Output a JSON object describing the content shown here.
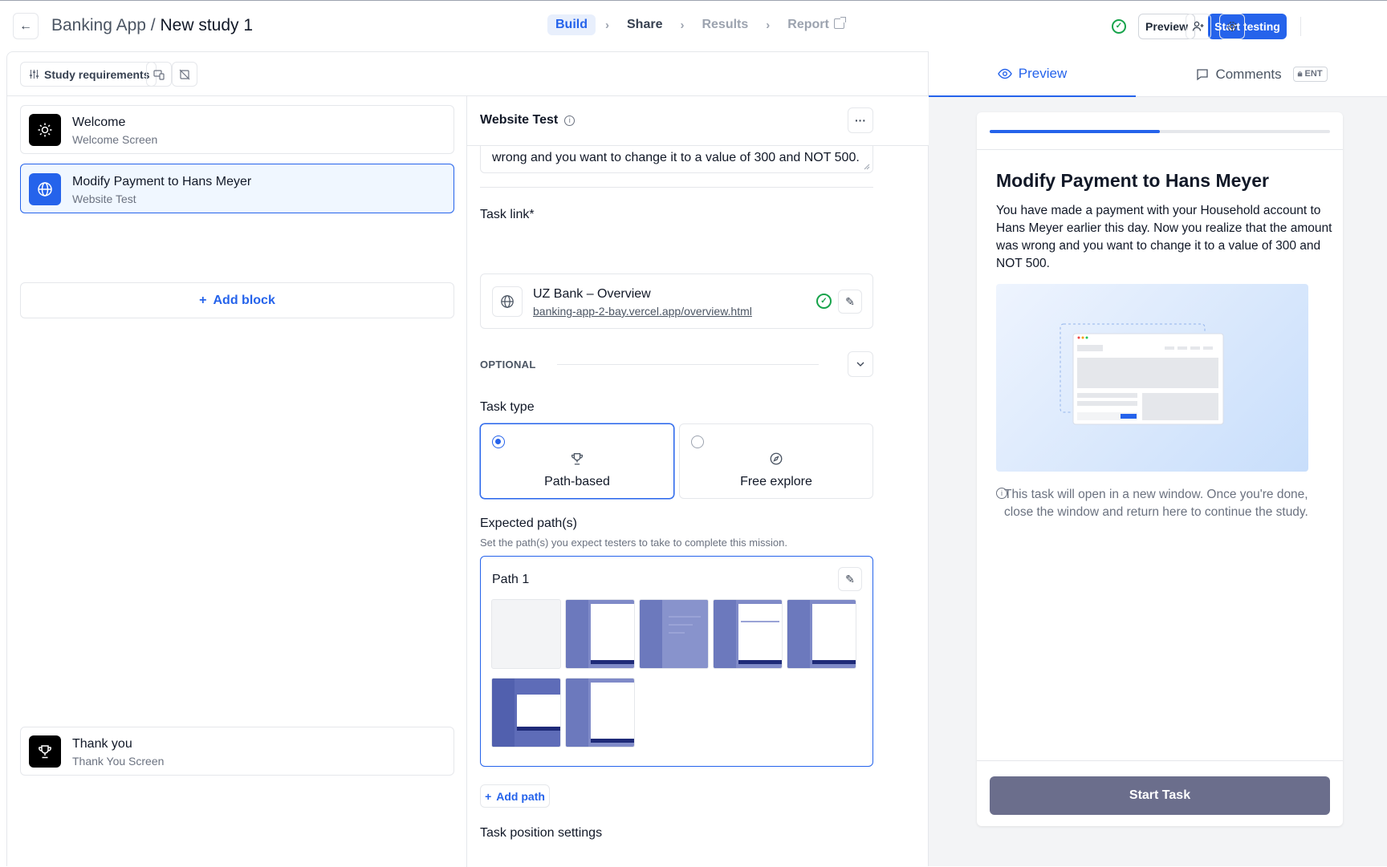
{
  "header": {
    "back_icon": "arrow-left-icon",
    "project": "Banking App",
    "separator": "/",
    "study": "New study 1",
    "steps": [
      {
        "label": "Build",
        "state": "active"
      },
      {
        "label": "Share",
        "state": "done"
      },
      {
        "label": "Results",
        "state": "disabled"
      },
      {
        "label": "Report",
        "state": "disabled"
      }
    ],
    "preview_label": "Preview",
    "start_label": "Start testing"
  },
  "toolbar": {
    "requirements_label": "Study requirements"
  },
  "blocks": [
    {
      "title": "Welcome",
      "subtitle": "Welcome Screen",
      "icon": "sun-icon"
    },
    {
      "title": "Modify Payment to Hans Meyer",
      "subtitle": "Website Test",
      "icon": "globe-icon"
    },
    {
      "title": "Thank you",
      "subtitle": "Thank You Screen",
      "icon": "trophy-icon"
    }
  ],
  "add_block_label": "Add block",
  "editor": {
    "title": "Website Test",
    "task_text_visible": "wrong and you want to change it to a value of 300 and NOT 500.",
    "task_link_label": "Task link*",
    "link_name": "UZ Bank – Overview",
    "link_url": "banking-app-2-bay.vercel.app/overview.html",
    "optional_label": "OPTIONAL",
    "task_type_label": "Task type",
    "task_types": [
      {
        "label": "Path-based",
        "selected": true,
        "icon": "trophy-icon"
      },
      {
        "label": "Free explore",
        "selected": false,
        "icon": "compass-icon"
      }
    ],
    "expected_paths_label": "Expected path(s)",
    "expected_paths_hint": "Set the path(s) you expect testers to take to complete this mission.",
    "path_title": "Path 1",
    "add_path_label": "Add path",
    "position_settings_label": "Task position settings"
  },
  "preview": {
    "tab_preview": "Preview",
    "tab_comments": "Comments",
    "ent_badge": "ENT",
    "progress": 0.5,
    "title": "Modify Payment to Hans Meyer",
    "description": "You have made a payment with your Household account to Hans Meyer earlier this day. Now you realize that the amount was wrong and you want to change it to a value of 300 and NOT 500.",
    "note": "This task will open in a new window. Once you're done, close the window and return here to continue the study.",
    "start_task_label": "Start Task"
  },
  "colors": {
    "accent": "#2563eb",
    "success": "#16a34a",
    "start_task_bg": "#6b6e8c"
  }
}
